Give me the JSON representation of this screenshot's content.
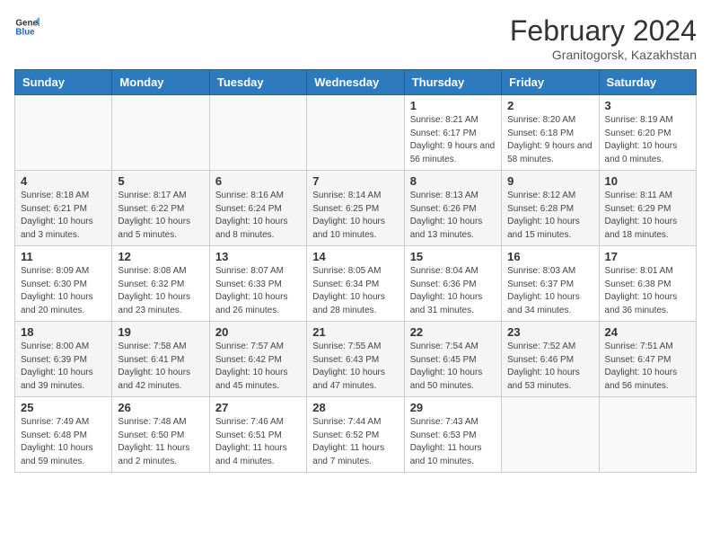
{
  "header": {
    "logo_general": "General",
    "logo_blue": "Blue",
    "month_title": "February 2024",
    "subtitle": "Granitogorsk, Kazakhstan"
  },
  "weekdays": [
    "Sunday",
    "Monday",
    "Tuesday",
    "Wednesday",
    "Thursday",
    "Friday",
    "Saturday"
  ],
  "weeks": [
    [
      {
        "day": "",
        "info": ""
      },
      {
        "day": "",
        "info": ""
      },
      {
        "day": "",
        "info": ""
      },
      {
        "day": "",
        "info": ""
      },
      {
        "day": "1",
        "info": "Sunrise: 8:21 AM\nSunset: 6:17 PM\nDaylight: 9 hours and 56 minutes."
      },
      {
        "day": "2",
        "info": "Sunrise: 8:20 AM\nSunset: 6:18 PM\nDaylight: 9 hours and 58 minutes."
      },
      {
        "day": "3",
        "info": "Sunrise: 8:19 AM\nSunset: 6:20 PM\nDaylight: 10 hours and 0 minutes."
      }
    ],
    [
      {
        "day": "4",
        "info": "Sunrise: 8:18 AM\nSunset: 6:21 PM\nDaylight: 10 hours and 3 minutes."
      },
      {
        "day": "5",
        "info": "Sunrise: 8:17 AM\nSunset: 6:22 PM\nDaylight: 10 hours and 5 minutes."
      },
      {
        "day": "6",
        "info": "Sunrise: 8:16 AM\nSunset: 6:24 PM\nDaylight: 10 hours and 8 minutes."
      },
      {
        "day": "7",
        "info": "Sunrise: 8:14 AM\nSunset: 6:25 PM\nDaylight: 10 hours and 10 minutes."
      },
      {
        "day": "8",
        "info": "Sunrise: 8:13 AM\nSunset: 6:26 PM\nDaylight: 10 hours and 13 minutes."
      },
      {
        "day": "9",
        "info": "Sunrise: 8:12 AM\nSunset: 6:28 PM\nDaylight: 10 hours and 15 minutes."
      },
      {
        "day": "10",
        "info": "Sunrise: 8:11 AM\nSunset: 6:29 PM\nDaylight: 10 hours and 18 minutes."
      }
    ],
    [
      {
        "day": "11",
        "info": "Sunrise: 8:09 AM\nSunset: 6:30 PM\nDaylight: 10 hours and 20 minutes."
      },
      {
        "day": "12",
        "info": "Sunrise: 8:08 AM\nSunset: 6:32 PM\nDaylight: 10 hours and 23 minutes."
      },
      {
        "day": "13",
        "info": "Sunrise: 8:07 AM\nSunset: 6:33 PM\nDaylight: 10 hours and 26 minutes."
      },
      {
        "day": "14",
        "info": "Sunrise: 8:05 AM\nSunset: 6:34 PM\nDaylight: 10 hours and 28 minutes."
      },
      {
        "day": "15",
        "info": "Sunrise: 8:04 AM\nSunset: 6:36 PM\nDaylight: 10 hours and 31 minutes."
      },
      {
        "day": "16",
        "info": "Sunrise: 8:03 AM\nSunset: 6:37 PM\nDaylight: 10 hours and 34 minutes."
      },
      {
        "day": "17",
        "info": "Sunrise: 8:01 AM\nSunset: 6:38 PM\nDaylight: 10 hours and 36 minutes."
      }
    ],
    [
      {
        "day": "18",
        "info": "Sunrise: 8:00 AM\nSunset: 6:39 PM\nDaylight: 10 hours and 39 minutes."
      },
      {
        "day": "19",
        "info": "Sunrise: 7:58 AM\nSunset: 6:41 PM\nDaylight: 10 hours and 42 minutes."
      },
      {
        "day": "20",
        "info": "Sunrise: 7:57 AM\nSunset: 6:42 PM\nDaylight: 10 hours and 45 minutes."
      },
      {
        "day": "21",
        "info": "Sunrise: 7:55 AM\nSunset: 6:43 PM\nDaylight: 10 hours and 47 minutes."
      },
      {
        "day": "22",
        "info": "Sunrise: 7:54 AM\nSunset: 6:45 PM\nDaylight: 10 hours and 50 minutes."
      },
      {
        "day": "23",
        "info": "Sunrise: 7:52 AM\nSunset: 6:46 PM\nDaylight: 10 hours and 53 minutes."
      },
      {
        "day": "24",
        "info": "Sunrise: 7:51 AM\nSunset: 6:47 PM\nDaylight: 10 hours and 56 minutes."
      }
    ],
    [
      {
        "day": "25",
        "info": "Sunrise: 7:49 AM\nSunset: 6:48 PM\nDaylight: 10 hours and 59 minutes."
      },
      {
        "day": "26",
        "info": "Sunrise: 7:48 AM\nSunset: 6:50 PM\nDaylight: 11 hours and 2 minutes."
      },
      {
        "day": "27",
        "info": "Sunrise: 7:46 AM\nSunset: 6:51 PM\nDaylight: 11 hours and 4 minutes."
      },
      {
        "day": "28",
        "info": "Sunrise: 7:44 AM\nSunset: 6:52 PM\nDaylight: 11 hours and 7 minutes."
      },
      {
        "day": "29",
        "info": "Sunrise: 7:43 AM\nSunset: 6:53 PM\nDaylight: 11 hours and 10 minutes."
      },
      {
        "day": "",
        "info": ""
      },
      {
        "day": "",
        "info": ""
      }
    ]
  ]
}
